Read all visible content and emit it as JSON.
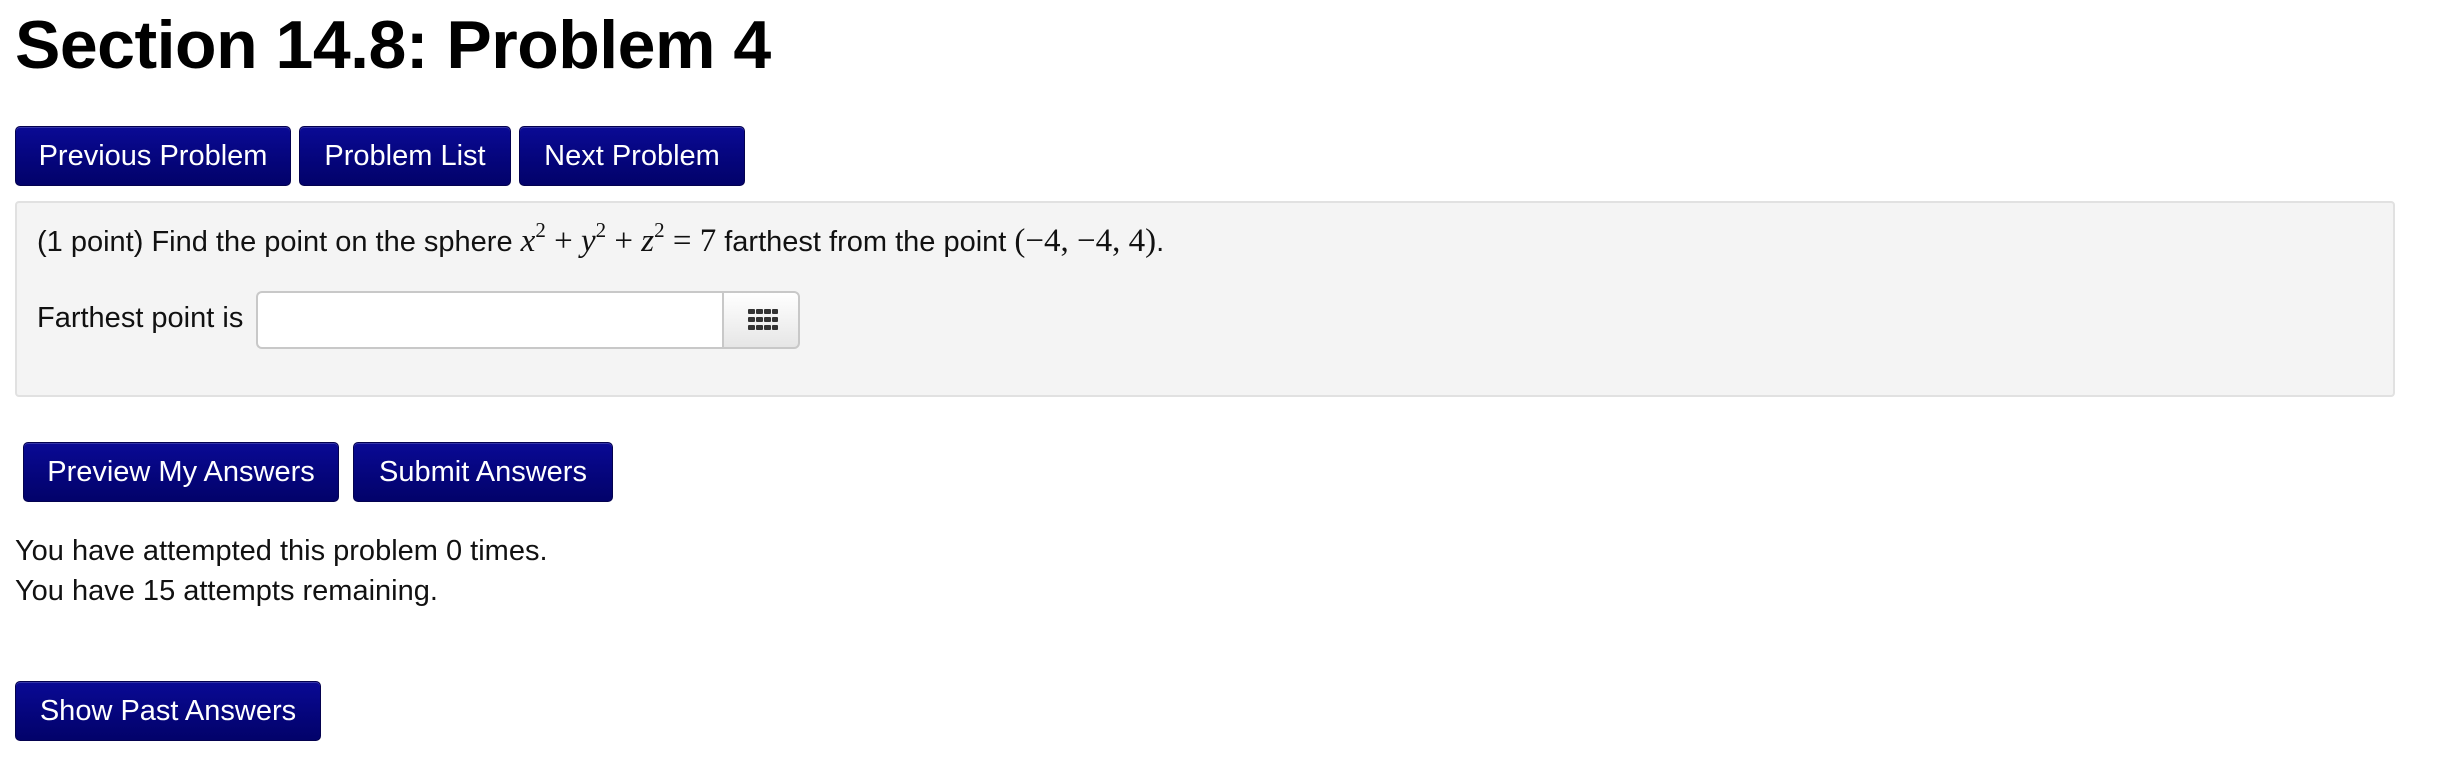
{
  "header": {
    "title": "Section 14.8: Problem 4"
  },
  "nav": {
    "previous_label": "Previous Problem",
    "list_label": "Problem List",
    "next_label": "Next Problem"
  },
  "problem": {
    "points": "(1 point)",
    "text_before": "Find the point on the sphere",
    "equation": {
      "x": "x",
      "y": "y",
      "z": "z",
      "exp": "2",
      "plus": "+",
      "equals": "=",
      "rhs": "7"
    },
    "text_middle": "farthest from the point",
    "point": "(−4, −4, 4)",
    "text_after": "."
  },
  "answer": {
    "label": "Farthest point is",
    "value": "",
    "placeholder": "",
    "palette_icon": "grid-icon"
  },
  "actions": {
    "preview_label": "Preview My Answers",
    "submit_label": "Submit Answers",
    "past_answers_label": "Show Past Answers"
  },
  "status": {
    "attempted": "You have attempted this problem 0 times.",
    "remaining": "You have 15 attempts remaining."
  },
  "colors": {
    "button_blue": "#05057c",
    "panel_bg": "#f4f4f4"
  }
}
